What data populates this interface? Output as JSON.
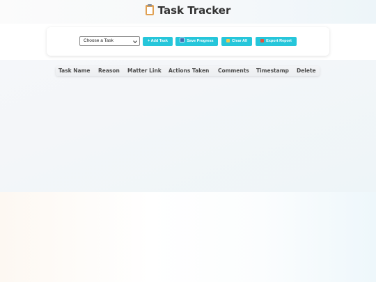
{
  "header": {
    "title": "Task Tracker",
    "icon": "clipboard-icon"
  },
  "toolbar": {
    "task_select": {
      "selected": "Choose a Task"
    },
    "add_label": "+ Add Task",
    "save_label": "Save Progress",
    "save_icon": "floppy-disk-icon",
    "clear_label": "Clear All",
    "clear_icon": "broom-icon",
    "export_label": "Export Report",
    "export_icon": "outbox-tray-icon"
  },
  "table": {
    "columns": [
      "Task Name",
      "Reason",
      "Matter Link",
      "Actions Taken",
      "Comments",
      "Timestamp",
      "Delete"
    ],
    "rows": []
  },
  "colors": {
    "accent": "#26c6da",
    "heading_text": "#333333",
    "table_header_bg": "#eceef1"
  }
}
